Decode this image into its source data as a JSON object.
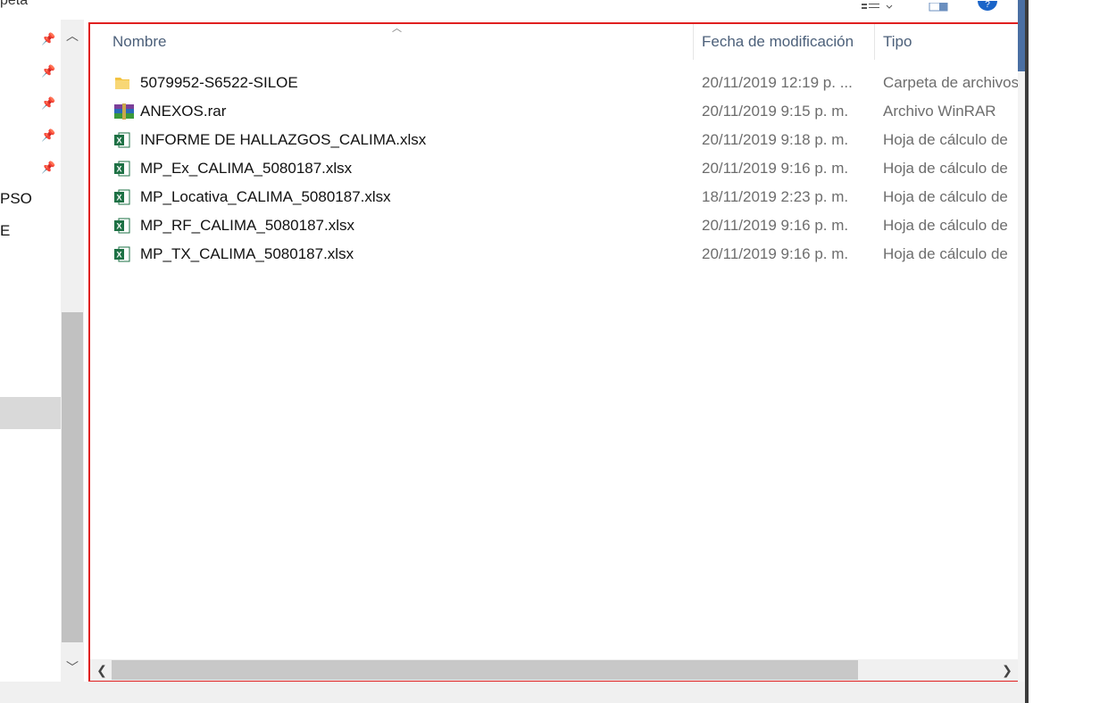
{
  "topbar": {
    "crumb": "peta"
  },
  "nav": {
    "items": [
      {
        "label": "PSO"
      },
      {
        "label": "E"
      }
    ]
  },
  "columns": {
    "name": "Nombre",
    "date": "Fecha de modificación",
    "type": "Tipo"
  },
  "files": [
    {
      "icon": "folder-icon",
      "name": "5079952-S6522-SILOE",
      "date": "20/11/2019 12:19 p. ...",
      "type": "Carpeta de archivos"
    },
    {
      "icon": "winrar-icon",
      "name": "ANEXOS.rar",
      "date": "20/11/2019 9:15 p. m.",
      "type": "Archivo WinRAR"
    },
    {
      "icon": "excel-icon",
      "name": "INFORME DE HALLAZGOS_CALIMA.xlsx",
      "date": "20/11/2019 9:18 p. m.",
      "type": "Hoja de cálculo de"
    },
    {
      "icon": "excel-icon",
      "name": "MP_Ex_CALIMA_5080187.xlsx",
      "date": "20/11/2019 9:16 p. m.",
      "type": "Hoja de cálculo de"
    },
    {
      "icon": "excel-icon",
      "name": "MP_Locativa_CALIMA_5080187.xlsx",
      "date": "18/11/2019 2:23 p. m.",
      "type": "Hoja de cálculo de"
    },
    {
      "icon": "excel-icon",
      "name": "MP_RF_CALIMA_5080187.xlsx",
      "date": "20/11/2019 9:16 p. m.",
      "type": "Hoja de cálculo de"
    },
    {
      "icon": "excel-icon",
      "name": "MP_TX_CALIMA_5080187.xlsx",
      "date": "20/11/2019 9:16 p. m.",
      "type": "Hoja de cálculo de"
    }
  ],
  "colors": {
    "highlight_border": "#e02020",
    "header_text": "#4c607a",
    "excel_green": "#1e7145",
    "folder_yellow": "#f3c341"
  }
}
